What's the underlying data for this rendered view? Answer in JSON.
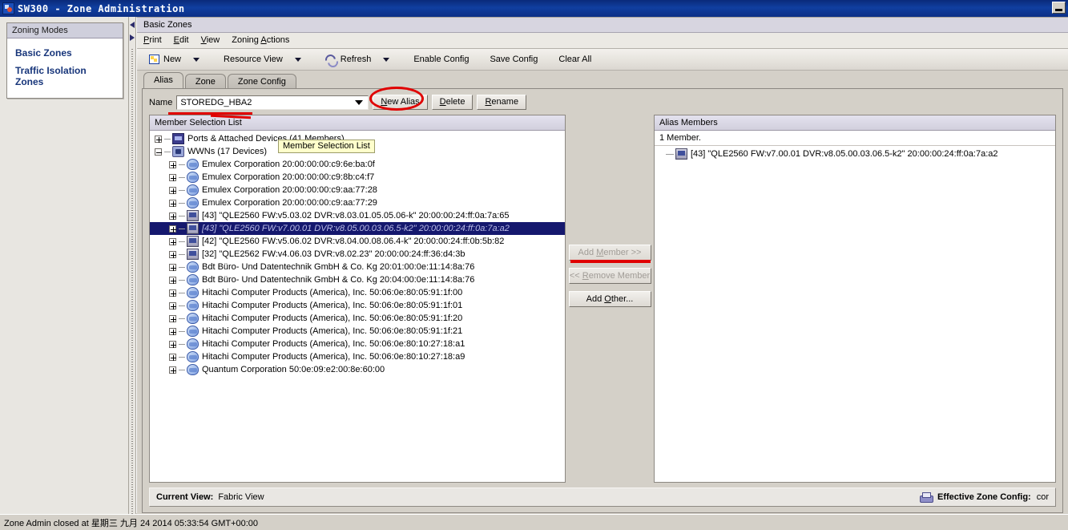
{
  "window": {
    "title": "SW300 - Zone Administration",
    "icon": "app-icon",
    "minimize_label": "minimize"
  },
  "sidebar": {
    "panel_title": "Zoning Modes",
    "links": [
      {
        "label": "Basic Zones"
      },
      {
        "label": "Traffic Isolation Zones"
      }
    ]
  },
  "content": {
    "doc_title": "Basic Zones",
    "menubar": [
      {
        "label": "Print",
        "mnemonic": "P"
      },
      {
        "label": "Edit",
        "mnemonic": "E"
      },
      {
        "label": "View",
        "mnemonic": "V"
      },
      {
        "label": "Zoning Actions",
        "mnemonic": "A"
      }
    ],
    "toolbar": [
      {
        "label": "New",
        "icon": "new-icon",
        "has_caret": true
      },
      {
        "label": "Resource View",
        "icon": "",
        "has_caret": true
      },
      {
        "label": "Refresh",
        "icon": "refresh-icon",
        "has_caret": true
      },
      {
        "label": "Enable Config",
        "icon": "",
        "has_caret": false
      },
      {
        "label": "Save Config",
        "icon": "",
        "has_caret": false
      },
      {
        "label": "Clear All",
        "icon": "",
        "has_caret": false
      }
    ],
    "tabs": [
      {
        "label": "Alias",
        "active": true
      },
      {
        "label": "Zone",
        "active": false
      },
      {
        "label": "Zone Config",
        "active": false
      }
    ],
    "name_row": {
      "label": "Name",
      "value": "STOREDG_HBA2",
      "placeholder": "",
      "buttons": [
        {
          "label": "New Alias",
          "mnemonic": "N",
          "disabled": false
        },
        {
          "label": "Delete",
          "mnemonic": "D",
          "disabled": false
        },
        {
          "label": "Rename",
          "mnemonic": "R",
          "disabled": false
        }
      ]
    }
  },
  "member_selection": {
    "title": "Member Selection List",
    "tooltip": "Member Selection List",
    "rows": [
      {
        "label": "Ports & Attached Devices (41 Members)",
        "depth": 0,
        "expander": "plus",
        "icon": "ports-icon",
        "selected": false
      },
      {
        "label": "WWNs (17 Devices)",
        "depth": 0,
        "expander": "minus",
        "icon": "wwns-icon",
        "selected": false
      },
      {
        "label": "Emulex Corporation 20:00:00:00:c9:6e:ba:0f",
        "depth": 1,
        "expander": "plus",
        "icon": "device-icon",
        "selected": false
      },
      {
        "label": "Emulex Corporation 20:00:00:00:c9:8b:c4:f7",
        "depth": 1,
        "expander": "plus",
        "icon": "device-icon",
        "selected": false
      },
      {
        "label": "Emulex Corporation 20:00:00:00:c9:aa:77:28",
        "depth": 1,
        "expander": "plus",
        "icon": "device-icon",
        "selected": false
      },
      {
        "label": "Emulex Corporation 20:00:00:00:c9:aa:77:29",
        "depth": 1,
        "expander": "plus",
        "icon": "device-icon",
        "selected": false
      },
      {
        "label": "[43] \"QLE2560 FW:v5.03.02 DVR:v8.03.01.05.05.06-k\" 20:00:00:24:ff:0a:7a:65",
        "depth": 1,
        "expander": "plus",
        "icon": "host-icon",
        "selected": false
      },
      {
        "label": "[43] \"QLE2560 FW:v7.00.01 DVR:v8.05.00.03.06.5-k2\" 20:00:00:24:ff:0a:7a:a2",
        "depth": 1,
        "expander": "plus",
        "icon": "host-icon",
        "selected": true
      },
      {
        "label": "[42] \"QLE2560 FW:v5.06.02 DVR:v8.04.00.08.06.4-k\" 20:00:00:24:ff:0b:5b:82",
        "depth": 1,
        "expander": "plus",
        "icon": "host-icon",
        "selected": false
      },
      {
        "label": "[32] \"QLE2562 FW:v4.06.03 DVR:v8.02.23\" 20:00:00:24:ff:36:d4:3b",
        "depth": 1,
        "expander": "plus",
        "icon": "host-icon",
        "selected": false
      },
      {
        "label": "Bdt Büro- Und Datentechnik GmbH & Co. Kg 20:01:00:0e:11:14:8a:76",
        "depth": 1,
        "expander": "plus",
        "icon": "device-icon",
        "selected": false
      },
      {
        "label": "Bdt Büro- Und Datentechnik GmbH & Co. Kg 20:04:00:0e:11:14:8a:76",
        "depth": 1,
        "expander": "plus",
        "icon": "device-icon",
        "selected": false
      },
      {
        "label": "Hitachi Computer Products (America), Inc. 50:06:0e:80:05:91:1f:00",
        "depth": 1,
        "expander": "plus",
        "icon": "device-icon",
        "selected": false
      },
      {
        "label": "Hitachi Computer Products (America), Inc. 50:06:0e:80:05:91:1f:01",
        "depth": 1,
        "expander": "plus",
        "icon": "device-icon",
        "selected": false
      },
      {
        "label": "Hitachi Computer Products (America), Inc. 50:06:0e:80:05:91:1f:20",
        "depth": 1,
        "expander": "plus",
        "icon": "device-icon",
        "selected": false
      },
      {
        "label": "Hitachi Computer Products (America), Inc. 50:06:0e:80:05:91:1f:21",
        "depth": 1,
        "expander": "plus",
        "icon": "device-icon",
        "selected": false
      },
      {
        "label": "Hitachi Computer Products (America), Inc. 50:06:0e:80:10:27:18:a1",
        "depth": 1,
        "expander": "plus",
        "icon": "device-icon",
        "selected": false
      },
      {
        "label": "Hitachi Computer Products (America), Inc. 50:06:0e:80:10:27:18:a9",
        "depth": 1,
        "expander": "plus",
        "icon": "device-icon",
        "selected": false
      },
      {
        "label": "Quantum Corporation 50:0e:09:e2:00:8e:60:00",
        "depth": 1,
        "expander": "plus",
        "icon": "device-icon",
        "selected": false
      }
    ]
  },
  "center_buttons": [
    {
      "label": "Add Member >>",
      "mnemonic": "M",
      "disabled": true
    },
    {
      "label": "<< Remove Member",
      "mnemonic": "R",
      "disabled": true
    },
    {
      "label": "Add Other...",
      "mnemonic": "O",
      "disabled": false
    }
  ],
  "alias_members": {
    "title": "Alias Members",
    "count_text": "1 Member.",
    "rows": [
      {
        "label": "[43] \"QLE2560 FW:v7.00.01 DVR:v8.05.00.03.06.5-k2\" 20:00:00:24:ff:0a:7a:a2",
        "icon": "host-icon"
      }
    ]
  },
  "view_bar": {
    "current_view_label": "Current View:",
    "current_view_value": "Fabric View",
    "print_icon": "print-icon",
    "effective_label": "Effective Zone Config:",
    "effective_value": "cor"
  },
  "status_bar": {
    "text": "Zone Admin closed at 星期三 九月 24 2014 05:33:54 GMT+00:00"
  },
  "colors": {
    "titlebar": "#103fa0",
    "selection": "#15186e",
    "link": "#17357a",
    "annotation_red": "#e00000",
    "tooltip_bg": "#ffffcc"
  }
}
